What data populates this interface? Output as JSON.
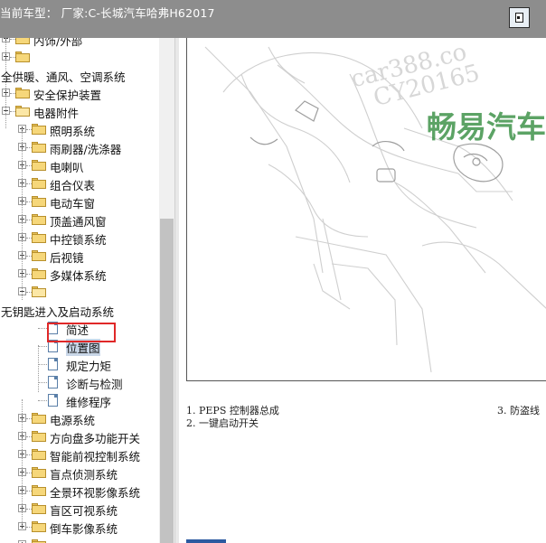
{
  "window": {
    "title": "当前车型： 厂家:C-长城汽车哈弗H62017"
  },
  "tree": {
    "items": [
      {
        "label": "内饰/外部",
        "type": "folder",
        "expander": "plus"
      },
      {
        "label": "",
        "type": "folder",
        "expander": "plus"
      },
      {
        "label": "全供暖、通风、空调系统",
        "type": "text"
      },
      {
        "label": "安全保护装置",
        "type": "folder",
        "expander": "plus"
      },
      {
        "label": "电器附件",
        "type": "folder-open",
        "expander": "minus"
      },
      {
        "label": "照明系统",
        "type": "folder",
        "expander": "plus"
      },
      {
        "label": "雨刷器/洗涤器",
        "type": "folder",
        "expander": "plus"
      },
      {
        "label": "电喇叭",
        "type": "folder",
        "expander": "plus"
      },
      {
        "label": "组合仪表",
        "type": "folder",
        "expander": "plus"
      },
      {
        "label": "电动车窗",
        "type": "folder",
        "expander": "plus"
      },
      {
        "label": "顶盖通风窗",
        "type": "folder",
        "expander": "plus"
      },
      {
        "label": "中控锁系统",
        "type": "folder",
        "expander": "plus"
      },
      {
        "label": "后视镜",
        "type": "folder",
        "expander": "plus"
      },
      {
        "label": "多媒体系统",
        "type": "folder",
        "expander": "plus"
      },
      {
        "label": "",
        "type": "folder-open",
        "expander": "minus"
      },
      {
        "label": "无钥匙进入及启动系统",
        "type": "text"
      },
      {
        "label": "简述",
        "type": "doc"
      },
      {
        "label": "位置图",
        "type": "doc",
        "selected": true
      },
      {
        "label": "规定力矩",
        "type": "doc"
      },
      {
        "label": "诊断与检测",
        "type": "doc"
      },
      {
        "label": "维修程序",
        "type": "doc"
      },
      {
        "label": "电源系统",
        "type": "folder",
        "expander": "plus"
      },
      {
        "label": "方向盘多功能开关",
        "type": "folder",
        "expander": "plus"
      },
      {
        "label": "智能前视控制系统",
        "type": "folder",
        "expander": "plus"
      },
      {
        "label": "盲点侦测系统",
        "type": "folder",
        "expander": "plus"
      },
      {
        "label": "全景环视影像系统",
        "type": "folder",
        "expander": "plus"
      },
      {
        "label": "盲区可视系统",
        "type": "folder",
        "expander": "plus"
      },
      {
        "label": "倒车影像系统",
        "type": "folder",
        "expander": "plus"
      },
      {
        "label": "",
        "type": "folder",
        "expander": "plus"
      }
    ]
  },
  "content": {
    "watermark_1": "car388.co",
    "watermark_2": "CY20165",
    "watermark_brand": "畅易汽车",
    "captions": [
      "1.   PEPS 控制器总成",
      "2.   一键启动开关",
      "3.   防盗线"
    ]
  }
}
